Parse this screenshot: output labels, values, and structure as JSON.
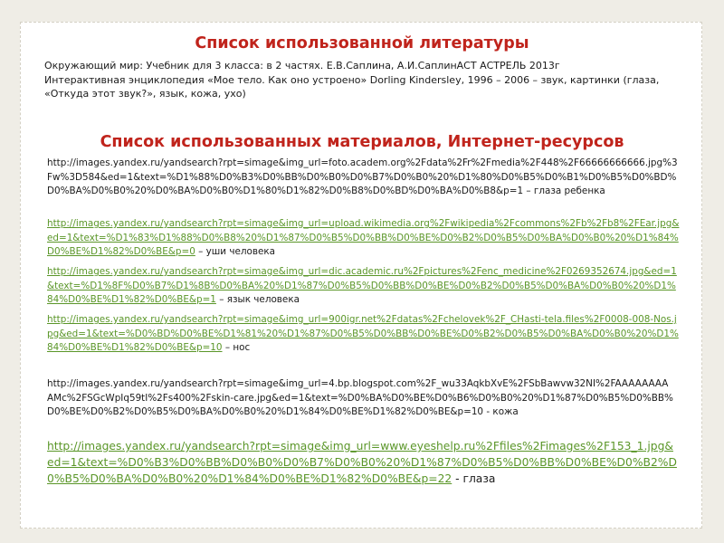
{
  "section1": {
    "title": "Список использованной литературы",
    "text": "Окружающий мир: Учебник для 3 класса: в 2 частях.  Е.В.Саплина, А.И.СаплинАСТ АСТРЕЛЬ 2013г\nИнтерактивная энциклопедия «Мое тело. Как оно устроено» Dorling Kindersley, 1996 – 2006 – звук, картинки (глаза, «Откуда этот звук?»,  язык, кожа, ухо)"
  },
  "section2": {
    "title": "Список использованных материалов, Интернет-ресурсов",
    "refs": [
      {
        "url": "http://images.yandex.ru/yandsearch?rpt=simage&img_url=foto.academ.org%2Fdata%2Fr%2Fmedia%2F448%2F66666666666.jpg%3Fw%3D584&ed=1&text=%D1%88%D0%B3%D0%BB%D0%B0%D0%B7%D0%B0%20%D1%80%D0%B5%D0%B1%D0%B5%D0%BD%D0%BA%D0%B0%20%D0%BA%D0%B0%D1%80%D1%82%D0%B8%D0%BD%D0%BA%D0%B8&p=1",
        "suffix": " – глаза ребенка",
        "linked": false
      },
      {
        "url": "http://images.yandex.ru/yandsearch?rpt=simage&img_url=upload.wikimedia.org%2Fwikipedia%2Fcommons%2Fb%2Fb8%2FEar.jpg&ed=1&text=%D1%83%D1%88%D0%B8%20%D1%87%D0%B5%D0%BB%D0%BE%D0%B2%D0%B5%D0%BA%D0%B0%20%D1%84%D0%BE%D1%82%D0%BE&p=0",
        "suffix": " – уши человека",
        "linked": true
      },
      {
        "url": "http://images.yandex.ru/yandsearch?rpt=simage&img_url=dic.academic.ru%2Fpictures%2Fenc_medicine%2F0269352674.jpg&ed=1&text=%D1%8F%D0%B7%D1%8B%D0%BA%20%D1%87%D0%B5%D0%BB%D0%BE%D0%B2%D0%B5%D0%BA%D0%B0%20%D1%84%D0%BE%D1%82%D0%BE&p=1",
        "suffix": " – язык человека",
        "linked": true
      },
      {
        "url": "http://images.yandex.ru/yandsearch?rpt=simage&img_url=900igr.net%2Fdatas%2Fchelovek%2F_CHasti-tela.files%2F0008-008-Nos.jpg&ed=1&text=%D0%BD%D0%BE%D1%81%20%D1%87%D0%B5%D0%BB%D0%BE%D0%B2%D0%B5%D0%BA%D0%B0%20%D1%84%D0%BE%D1%82%D0%BE&p=10",
        "suffix": " – нос",
        "linked": true
      },
      {
        "url": "http://images.yandex.ru/yandsearch?rpt=simage&img_url=4.bp.blogspot.com%2F_wu33AqkbXvE%2FSbBawvw32NI%2FAAAAAAAAAMc%2FSGcWpIq59tI%2Fs400%2Fskin-care.jpg&ed=1&text=%D0%BA%D0%BE%D0%B6%D0%B0%20%D1%87%D0%B5%D0%BB%D0%BE%D0%B2%D0%B5%D0%BA%D0%B0%20%D1%84%D0%BE%D1%82%D0%BE&p=10",
        "suffix": " - кожа",
        "linked": false
      },
      {
        "url": "http://images.yandex.ru/yandsearch?rpt=simage&img_url=www.eyeshelp.ru%2Ffiles%2Fimages%2F153_1.jpg&ed=1&text=%D0%B3%D0%BB%D0%B0%D0%B7%D0%B0%20%D1%87%D0%B5%D0%BB%D0%BE%D0%B2%D0%B5%D0%BA%D0%B0%20%D1%84%D0%BE%D1%82%D0%BE&p=22",
        "suffix": " - глаза",
        "linked": true
      }
    ]
  },
  "colors": {
    "title": "#c0241c",
    "link": "#5a9628",
    "background": "#efede6",
    "panel": "#ffffff"
  }
}
